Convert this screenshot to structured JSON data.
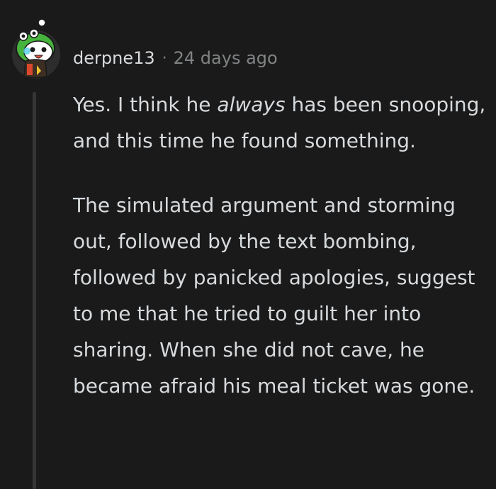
{
  "comment": {
    "author": "derpne13",
    "separator": "·",
    "timestamp": "24 days ago",
    "avatar_icon": "snoo-avatar-icon",
    "paragraphs": [
      {
        "before": "Yes. I think he ",
        "emphasis": "always",
        "after": " has been snooping, and this time he found something."
      },
      {
        "text": "The simulated argument and storming out, followed by the text bombing, followed by panicked apologies, suggest to me that he tried to guilt her into sharing. When she did not cave, he became afraid his meal ticket was gone."
      }
    ]
  },
  "colors": {
    "background": "#1a1a1b",
    "text": "#d7dadc",
    "meta": "#818384",
    "thread_line": "#343536"
  }
}
